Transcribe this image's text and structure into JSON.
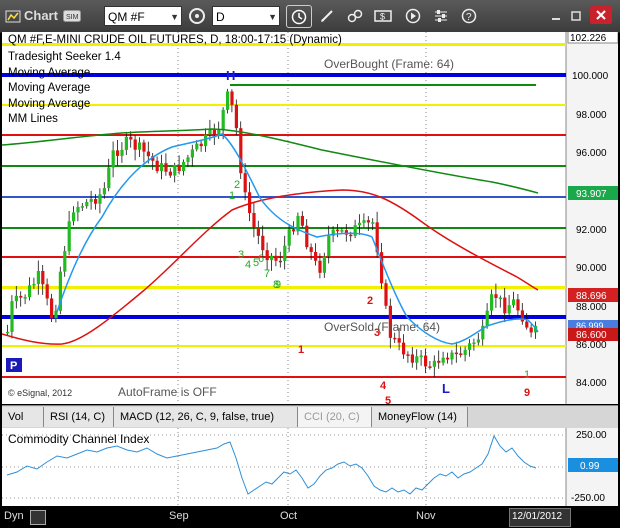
{
  "toolbar": {
    "window_title": "Chart",
    "symbol_field": "QM #F",
    "interval_field": "D"
  },
  "chart": {
    "header_line": "QM #F,E-MINI CRUDE OIL FUTURES, D, 18:00-17:15 (Dynamic)",
    "studies": [
      "Tradesight Seeker 1.4",
      "Moving Average",
      "Moving Average",
      "Moving Average",
      "MM Lines"
    ],
    "overbought_label": "OverBought (Frame: 64)",
    "oversold_label": "OverSold (Frame: 64)",
    "copyright": "© eSignal, 2012",
    "autoframe": "AutoFrame is OFF",
    "p_button": "P",
    "high_marker": "H",
    "low_marker": "L",
    "price_ticks": [
      "102.226",
      "100.000",
      "98.000",
      "96.000",
      "94.000",
      "92.000",
      "90.000",
      "88.000",
      "86.000",
      "84.000"
    ],
    "price_tags": [
      {
        "value": "93.907",
        "color": "#1aa84a"
      },
      {
        "value": "88.696",
        "color": "#d42020"
      },
      {
        "value": "86.600",
        "color": "#c81818"
      },
      {
        "value": "86.999",
        "color": "#ffffff"
      }
    ],
    "seq_green": [
      "2",
      "1",
      "3",
      "4",
      "5",
      "6",
      "7",
      "8",
      "9",
      "1"
    ],
    "seq_red": [
      "1",
      "2",
      "3",
      "4",
      "5",
      "9"
    ],
    "months": [
      "Sep",
      "Oct",
      "Nov"
    ],
    "date_label": "12/01/2012"
  },
  "tabs": [
    "Vol",
    "RSI (14, C)",
    "MACD (12, 26, C, 9, false, true)",
    "CCI (20, C)",
    "MoneyFlow (14)"
  ],
  "cci": {
    "title": "Commodity Channel Index",
    "ticks": [
      "250.00",
      "-250.00"
    ],
    "current_value": "0.99"
  },
  "bottom": {
    "dyn": "Dyn"
  },
  "colors": {
    "accent_blue": "#0000dd",
    "ma_green": "#118811",
    "ma_red": "#dd1111",
    "ma_blue": "#2299ee",
    "mm_yellow": "#f0f000",
    "mm_red": "#e01010",
    "up_candle": "#22bb22",
    "down_candle": "#dd1111"
  }
}
